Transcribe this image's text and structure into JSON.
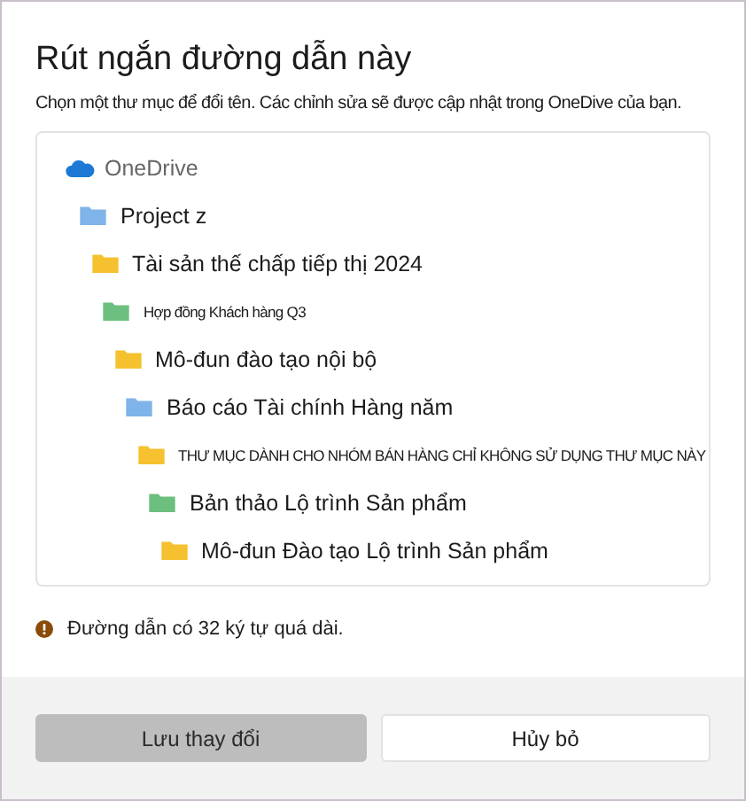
{
  "dialog": {
    "title": "Rút ngắn đường dẫn này",
    "description": "Chọn một thư mục để đổi tên. Các chỉnh sửa sẽ được cập nhật trong OneDive của bạn."
  },
  "tree": {
    "root": "OneDrive",
    "children": [
      {
        "label": "Project z",
        "color": "#7fb4ea",
        "kind": "normal",
        "children": [
          {
            "label": "Tài sản thế chấp tiếp thị 2024",
            "color": "#f5c12e",
            "kind": "normal",
            "children": [
              {
                "label": "Hợp đồng Khách hàng Q3",
                "color": "#6cbf7e",
                "kind": "small",
                "children": [
                  {
                    "label": "Mô-đun đào tạo nội bộ",
                    "color": "#f5c12e",
                    "kind": "normal",
                    "children": [
                      {
                        "label": "Báo cáo Tài chính Hàng năm",
                        "color": "#7fb4ea",
                        "kind": "normal",
                        "children": [
                          {
                            "label": "THƯ MỤC DÀNH CHO NHÓM BÁN HÀNG CHỈ KHÔNG SỬ DỤNG THƯ MỤC NÀY",
                            "color": "#f5c12e",
                            "kind": "small",
                            "children": [
                              {
                                "label": "Bản thảo Lộ trình Sản phẩm",
                                "color": "#6cbf7e",
                                "kind": "normal",
                                "children": [
                                  {
                                    "label": "Mô-đun Đào tạo Lộ trình Sản phẩm",
                                    "color": "#f5c12e",
                                    "kind": "normal"
                                  }
                                ]
                              }
                            ]
                          }
                        ]
                      }
                    ]
                  }
                ]
              }
            ]
          }
        ]
      }
    ]
  },
  "warning": "Đường dẫn có 32 ký tự quá dài.",
  "buttons": [
    {
      "label": "Lưu thay đổi",
      "disabled": true
    },
    {
      "label": "Hủy bỏ",
      "disabled": false
    }
  ]
}
